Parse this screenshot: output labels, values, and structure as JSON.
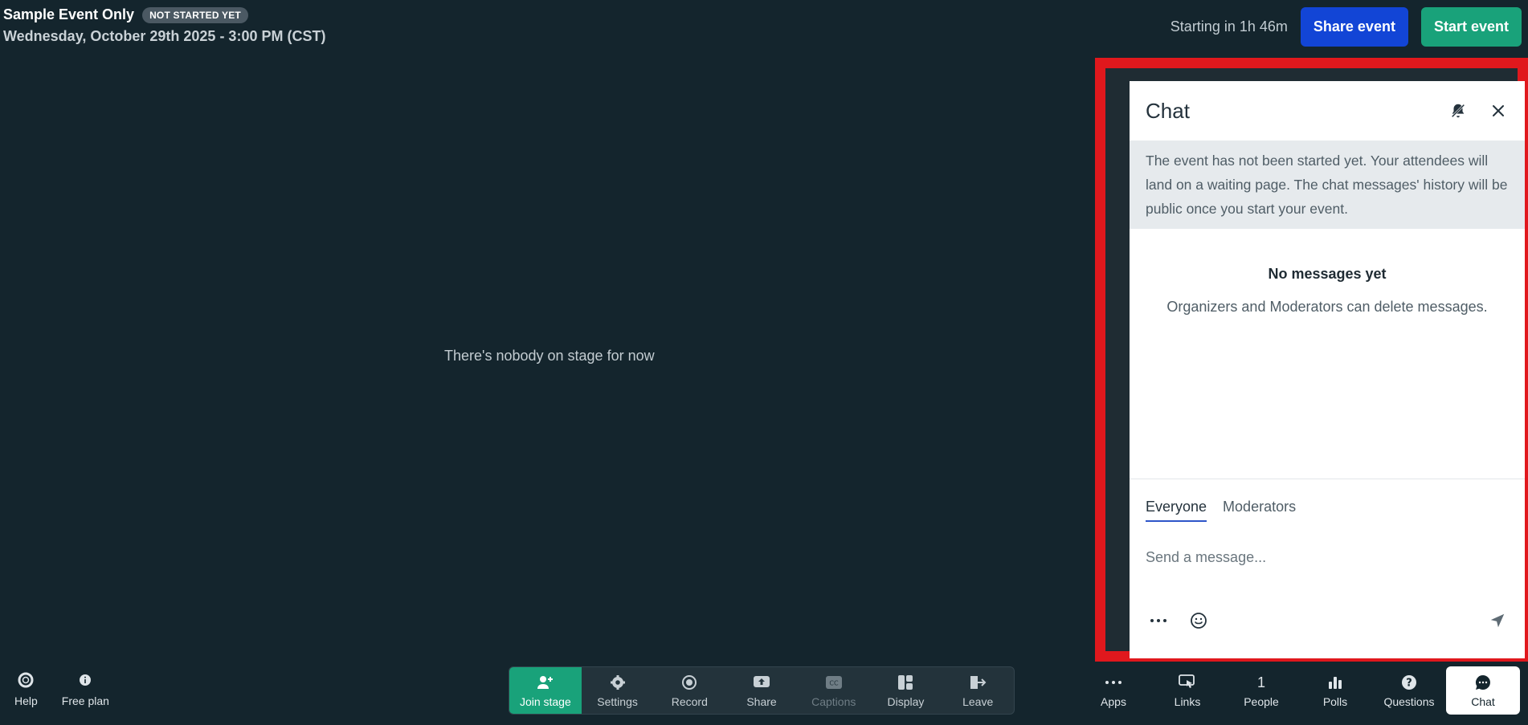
{
  "header": {
    "title": "Sample Event Only",
    "status_badge": "NOT STARTED YET",
    "date": "Wednesday, October 29th 2025 - 3:00 PM (CST)",
    "countdown": "Starting in 1h 46m",
    "share_label": "Share event",
    "start_label": "Start event"
  },
  "stage": {
    "empty_text": "There's nobody on stage for now"
  },
  "chat": {
    "title": "Chat",
    "notice": "The event has not been started yet. Your attendees will land on a waiting page. The chat messages' history will be public once you start your event.",
    "empty_title": "No messages yet",
    "empty_subtitle": "Organizers and Moderators can delete messages.",
    "tabs": [
      {
        "label": "Everyone",
        "active": true
      },
      {
        "label": "Moderators",
        "active": false
      }
    ],
    "input_placeholder": "Send a message...",
    "highlight_color": "#e0181d"
  },
  "bottom_left": [
    {
      "label": "Help",
      "icon": "lifebuoy-icon"
    },
    {
      "label": "Free plan",
      "icon": "info-icon"
    }
  ],
  "toolbar": [
    {
      "label": "Join stage",
      "icon": "user-plus-icon"
    },
    {
      "label": "Settings",
      "icon": "gear-icon"
    },
    {
      "label": "Record",
      "icon": "record-icon"
    },
    {
      "label": "Share",
      "icon": "screen-share-icon"
    },
    {
      "label": "Captions",
      "icon": "captions-icon"
    },
    {
      "label": "Display",
      "icon": "layout-icon"
    },
    {
      "label": "Leave",
      "icon": "leave-icon"
    }
  ],
  "bottom_right": [
    {
      "label": "Apps",
      "icon": "more-icon"
    },
    {
      "label": "Links",
      "icon": "link-cursor-icon"
    },
    {
      "label": "People",
      "count": "1"
    },
    {
      "label": "Polls",
      "icon": "bar-chart-icon"
    },
    {
      "label": "Questions",
      "icon": "question-icon"
    },
    {
      "label": "Chat",
      "icon": "chat-icon"
    }
  ],
  "colors": {
    "accent_green": "#19a27a",
    "accent_blue": "#1245d6",
    "background": "#14252d"
  }
}
